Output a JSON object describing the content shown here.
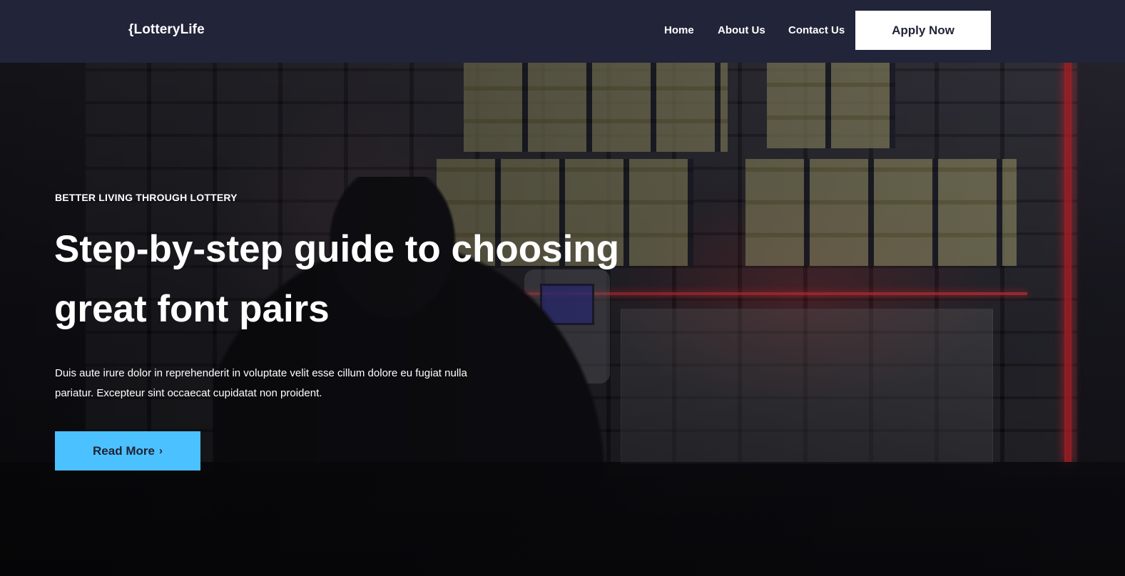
{
  "header": {
    "brand": "{LotteryLife",
    "nav": {
      "home": "Home",
      "about": "About Us",
      "contact": "Contact Us"
    },
    "cta_label": "Apply Now"
  },
  "hero": {
    "eyebrow": "BETTER LIVING THROUGH LOTTERY",
    "headline": "Step-by-step guide to choosing great font pairs",
    "body": "Duis aute irure dolor in reprehenderit in voluptate velit esse cillum dolore eu fugiat nulla pariatur. Excepteur sint occaecat cupidatat non proident.",
    "read_more_label": "Read More",
    "read_more_icon": "chevron-right-icon"
  },
  "colors": {
    "header_bg": "#22243a",
    "cta_bg": "#ffffff",
    "read_more_bg": "#4cc1ff",
    "text": "#ffffff"
  }
}
